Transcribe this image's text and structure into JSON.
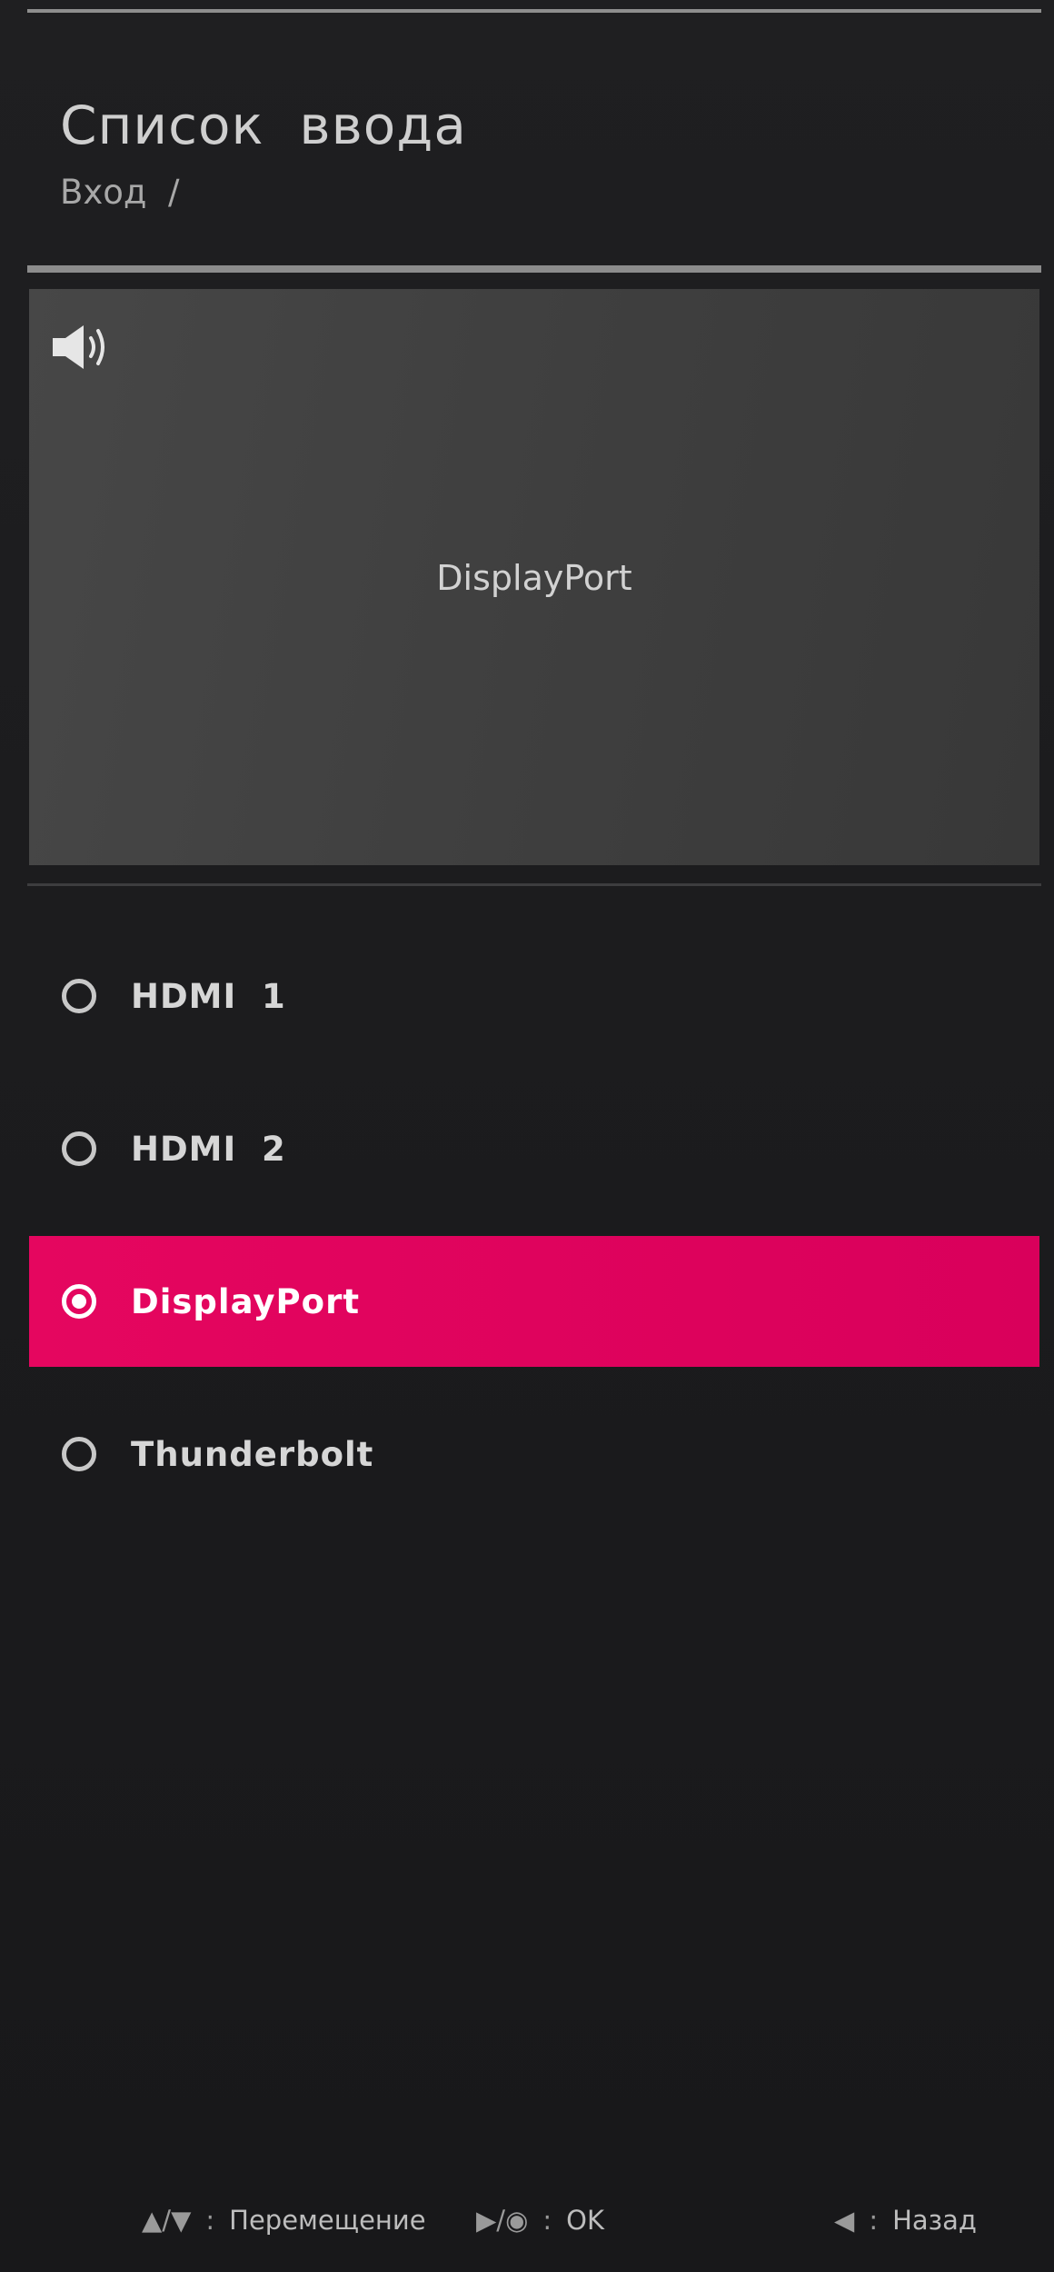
{
  "header": {
    "title": "Список  ввода",
    "breadcrumb": "Вход  /"
  },
  "preview": {
    "audio_icon": "speaker-icon",
    "current_input": "DisplayPort"
  },
  "inputs": [
    {
      "label": "HDMI  1",
      "selected": false
    },
    {
      "label": "HDMI  2",
      "selected": false
    },
    {
      "label": "DisplayPort",
      "selected": true
    },
    {
      "label": "Thunderbolt",
      "selected": false
    }
  ],
  "footer": {
    "move": {
      "keys": "▲/▼",
      "sep": ":",
      "label": "Перемещение"
    },
    "ok": {
      "keys": "▶/◉",
      "sep": ":",
      "label": "OK"
    },
    "back": {
      "keys": "◀",
      "sep": ":",
      "label": "Назад"
    }
  },
  "colors": {
    "accent": "#e0065e",
    "background": "#1d1d1f",
    "preview": "#404040"
  }
}
